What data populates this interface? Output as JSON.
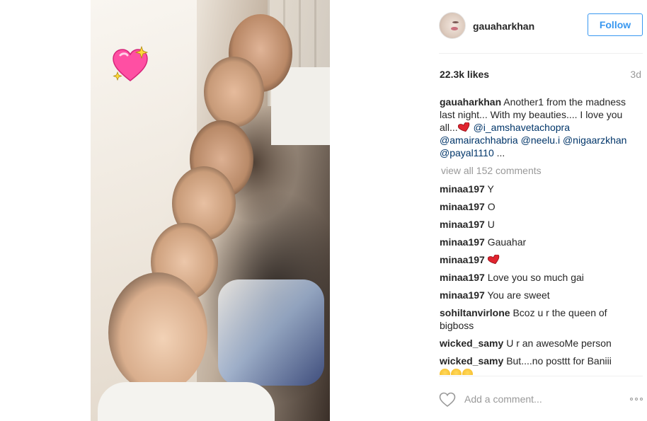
{
  "post": {
    "username": "gauaharkhan",
    "follow_label": "Follow",
    "likes": "22.3k likes",
    "age": "3d",
    "caption": {
      "username": "gauaharkhan",
      "text": "Another1 from the madness last night... With my beauties.... I love you all...",
      "mentions": [
        "@i_amshavetachopra",
        "@amairachhabria",
        "@neelu.i",
        "@nigaarzkhan",
        "@payal1110"
      ],
      "ellipsis": "..."
    },
    "view_all_comments": "view all 152 comments"
  },
  "comments": [
    {
      "user": "minaa197",
      "text": "Y"
    },
    {
      "user": "minaa197",
      "text": "O"
    },
    {
      "user": "minaa197",
      "text": "U"
    },
    {
      "user": "minaa197",
      "text": "Gauahar"
    },
    {
      "user": "minaa197",
      "text": "",
      "icon": "red-heart-icon"
    },
    {
      "user": "minaa197",
      "text": "Love you so much gai"
    },
    {
      "user": "minaa197",
      "text": "You are sweet"
    },
    {
      "user": "sohiltanvirlone",
      "text": "Bcoz u r the queen of bigboss"
    },
    {
      "user": "wicked_samy",
      "text": "U r an awesoMe person"
    },
    {
      "user": "wicked_samy",
      "text": "But....no posttt for Baniii",
      "icon": "sad-face-emoji-icon"
    }
  ],
  "footer": {
    "add_comment_placeholder": "Add a comment..."
  },
  "colors": {
    "accent": "#3897f0",
    "mention": "#003569",
    "muted": "#999999",
    "text": "#262626"
  },
  "icons": {
    "sticker": "sparkling-heart-icon",
    "like": "heart-outline-icon",
    "more": "more-options-icon"
  }
}
